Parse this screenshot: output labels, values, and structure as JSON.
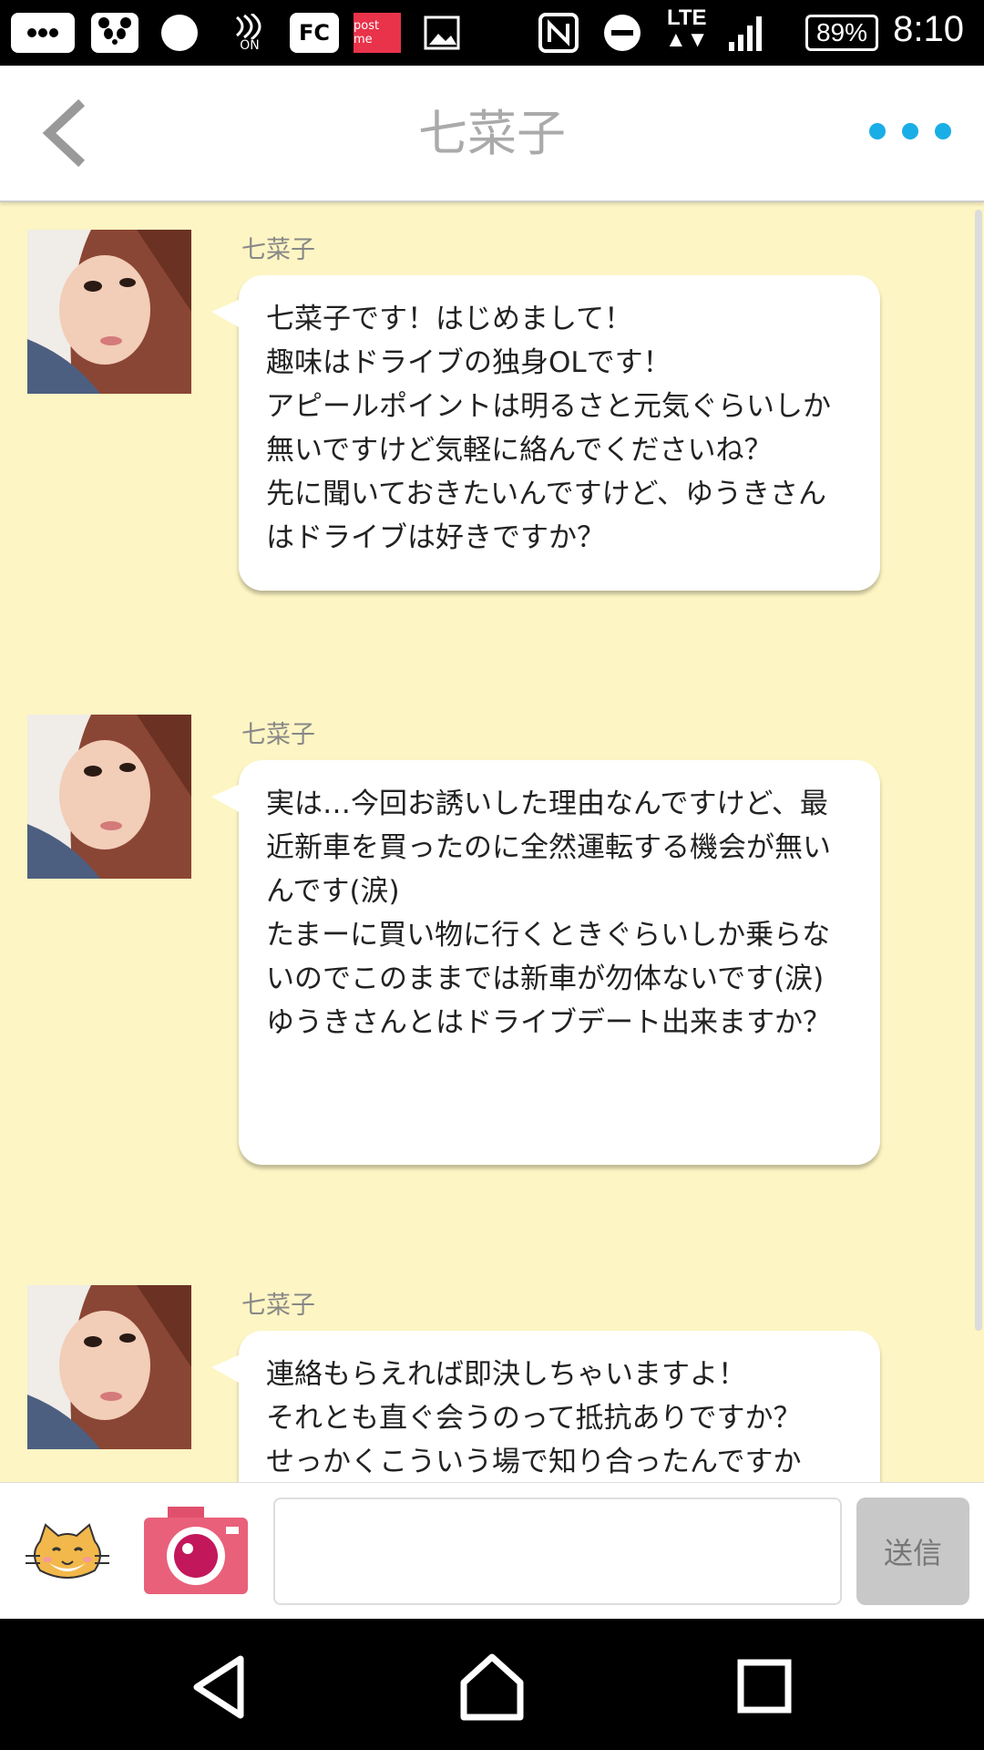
{
  "status_bar": {
    "time": "8:10",
    "battery": "89%",
    "network": "LTE",
    "fc_label": "FC",
    "postme_label": "post me",
    "on_label": "ON",
    "icons": [
      "more-notifications-icon",
      "panda-icon",
      "circle-icon",
      "nfc-on-icon",
      "fc-icon",
      "postme-icon",
      "image-icon",
      "nfc-icon",
      "do-not-disturb-icon",
      "lte-icon",
      "signal-icon",
      "battery-icon"
    ]
  },
  "header": {
    "title": "七菜子",
    "back_icon": "chevron-left-icon",
    "more_icon": "more-dots-icon"
  },
  "messages": [
    {
      "sender": "七菜子",
      "text": "七菜子です！はじめまして！\n趣味はドライブの独身OLです！\nアピールポイントは明るさと元気ぐらいしか無いですけど気軽に絡んでくださいね？\n先に聞いておきたいんですけど、ゆうきさんはドライブは好きですか？"
    },
    {
      "sender": "七菜子",
      "text": "実は…今回お誘いした理由なんですけど、最近新車を買ったのに全然運転する機会が無いんです(涙)\nたまーに買い物に行くときぐらいしか乗らないのでこのままでは新車が勿体ないです(涙)\nゆうきさんとはドライブデート出来ますか？"
    },
    {
      "sender": "七菜子",
      "text": "連絡もらえれば即決しちゃいますよ！\nそれとも直ぐ会うのって抵抗ありですか？\nせっかくこういう場で知り合ったんですか"
    }
  ],
  "input_bar": {
    "sticker_icon": "cat-sticker-icon",
    "camera_icon": "camera-icon",
    "input_value": "",
    "input_placeholder": "",
    "send_label": "送信"
  },
  "nav_bar": {
    "icons": [
      "back-triangle-icon",
      "home-icon",
      "recents-icon"
    ]
  },
  "colors": {
    "chat_background": "#fdf5c3",
    "accent_dots": "#1aaee6",
    "send_button": "#c8c8c8"
  }
}
